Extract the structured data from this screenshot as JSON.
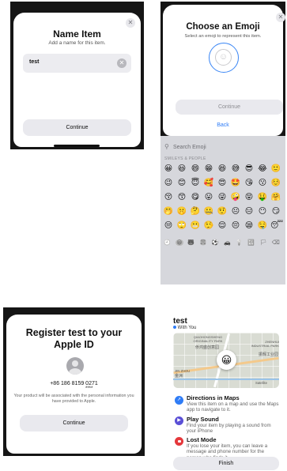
{
  "name_item": {
    "title": "Name Item",
    "subtitle": "Add a name for this item.",
    "field_value": "test",
    "continue_label": "Continue"
  },
  "choose_emoji": {
    "title": "Choose an Emoji",
    "subtitle": "Select an emoji to represent this item.",
    "continue_label": "Continue",
    "back_label": "Back",
    "search_placeholder": "Search Emoji",
    "category_label": "SMILEYS & PEOPLE",
    "emojis": [
      "😀",
      "😃",
      "😄",
      "😁",
      "😆",
      "😅",
      "😎",
      "😂",
      "🙂",
      "😉",
      "😊",
      "😇",
      "🥰",
      "😍",
      "🤩",
      "😘",
      "😗",
      "☺️",
      "😚",
      "😙",
      "😋",
      "😛",
      "😜",
      "🤪",
      "😝",
      "🤑",
      "🤗",
      "🤭",
      "🤫",
      "🤔",
      "🤐",
      "🤨",
      "😐",
      "😑",
      "😶",
      "😏",
      "😒",
      "🙄",
      "😬",
      "🤥",
      "😌",
      "😔",
      "😪",
      "🤤",
      "😴"
    ],
    "category_icons": [
      "🕘",
      "😀",
      "🐻",
      "🍔",
      "⚽",
      "🚗",
      "💡",
      "🔣",
      "🏳",
      "⌫"
    ]
  },
  "register": {
    "title_line1": "Register test to your",
    "title_line2": "Apple ID",
    "phone": "+86 186 8159 0271",
    "phone_mask": "****",
    "info": "Your product will be associated with the personal information you have provided to Apple.",
    "continue_label": "Continue"
  },
  "item_detail": {
    "title": "test",
    "status": "With You",
    "map_labels": [
      "QIAOHONGSHENG ORIGINALITY PARK",
      "侨鸿盛创意园",
      "ZHENHUI INDUSTRIAL PARK",
      "振辉工业园",
      "JIN ZHOU",
      "金洲",
      "Satellite"
    ],
    "pin_emoji": "😀",
    "actions": [
      {
        "title": "Directions in Maps",
        "text": "View this item on a map and use the Maps app to navigate to it.",
        "icon": "↗",
        "color": "#2f7cf6"
      },
      {
        "title": "Play Sound",
        "text": "Find your item by playing a sound from your iPhone",
        "icon": "▶",
        "color": "#5a4fd6"
      },
      {
        "title": "Lost Mode",
        "text": "If you lose your item, you can leave a message and phone number for the person who finds it.",
        "icon": "🔒",
        "color": "#e5383b"
      }
    ],
    "finish_label": "Finish"
  }
}
